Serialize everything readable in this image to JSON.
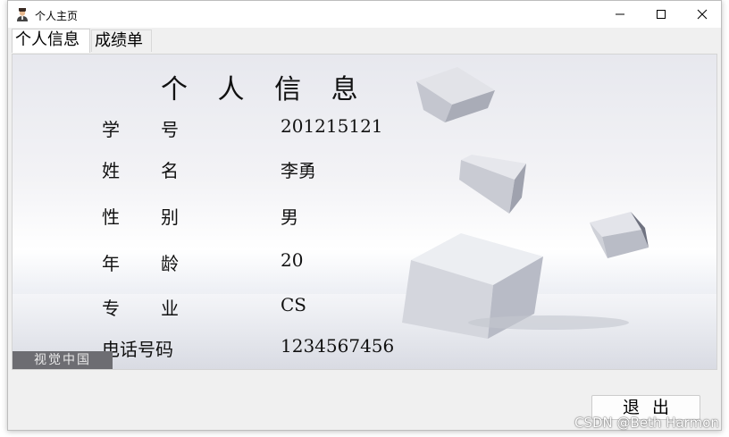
{
  "window": {
    "title": "个人主页"
  },
  "tabs": [
    {
      "label": "个人信息",
      "active": true
    },
    {
      "label": "成绩单",
      "active": false
    }
  ],
  "info": {
    "heading": "个 人 信 息",
    "fields": [
      {
        "label_a": "学",
        "label_b": "号",
        "value": "201215121"
      },
      {
        "label_a": "姓",
        "label_b": "名",
        "value": "李勇"
      },
      {
        "label_a": "性",
        "label_b": "别",
        "value": "男"
      },
      {
        "label_a": "年",
        "label_b": "龄",
        "value": "20"
      },
      {
        "label_a": "专",
        "label_b": "业",
        "value": "CS"
      },
      {
        "label_full": "电话号码",
        "value": "1234567456"
      }
    ],
    "watermark": "视觉中国"
  },
  "exit_button": {
    "label": "退出"
  },
  "overlay_watermark": "CSDN @Beth Harmon",
  "icons": {
    "app": "avatar-icon",
    "minimize": "minimize-icon",
    "maximize": "maximize-icon",
    "close": "close-icon"
  },
  "colors": {
    "window_bg": "#f0f0f0",
    "panel_watermark_bg": "#6d6d72"
  }
}
